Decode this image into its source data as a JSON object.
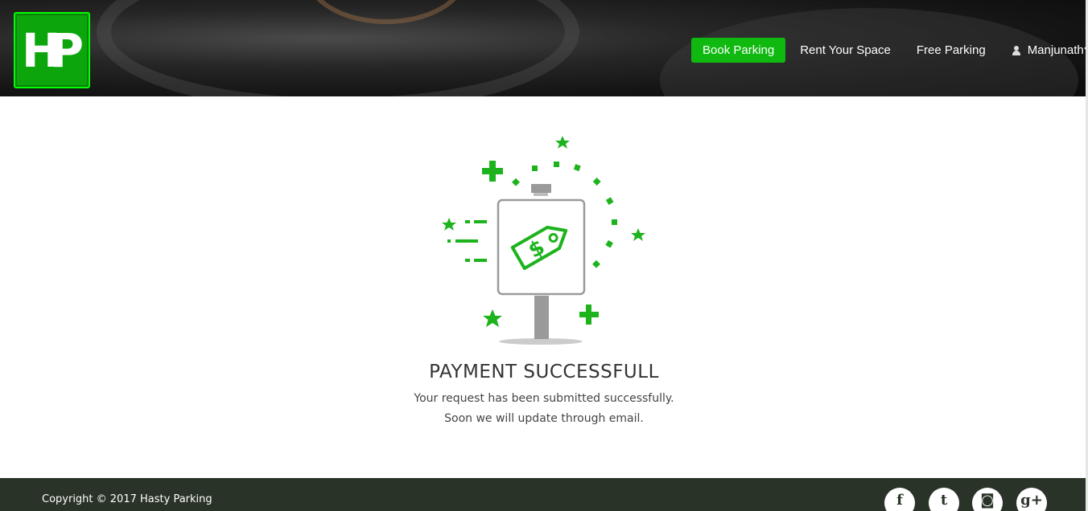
{
  "header": {
    "logo_text": "HP",
    "nav": {
      "book_parking": "Book Parking",
      "rent_space": "Rent Your Space",
      "free_parking": "Free Parking",
      "user_name": "Manjunath"
    }
  },
  "main": {
    "title": "PAYMENT SUCCESSFULL",
    "message_line1": "Your request has been submitted successfully.",
    "message_line2": "Soon we will update through email.",
    "tag_symbol": "$"
  },
  "footer": {
    "copyright": "Copyright © 2017 Hasty Parking",
    "social": [
      {
        "icon": "facebook-icon",
        "glyph": "f"
      },
      {
        "icon": "twitter-icon",
        "glyph": "t"
      },
      {
        "icon": "instagram-icon",
        "glyph": "◙"
      },
      {
        "icon": "google-plus-icon",
        "glyph": "g+"
      }
    ]
  },
  "colors": {
    "accent": "#10b910",
    "footer_bg": "#2a3328",
    "illustration_green": "#1db31d",
    "sign_gray": "#999999"
  }
}
